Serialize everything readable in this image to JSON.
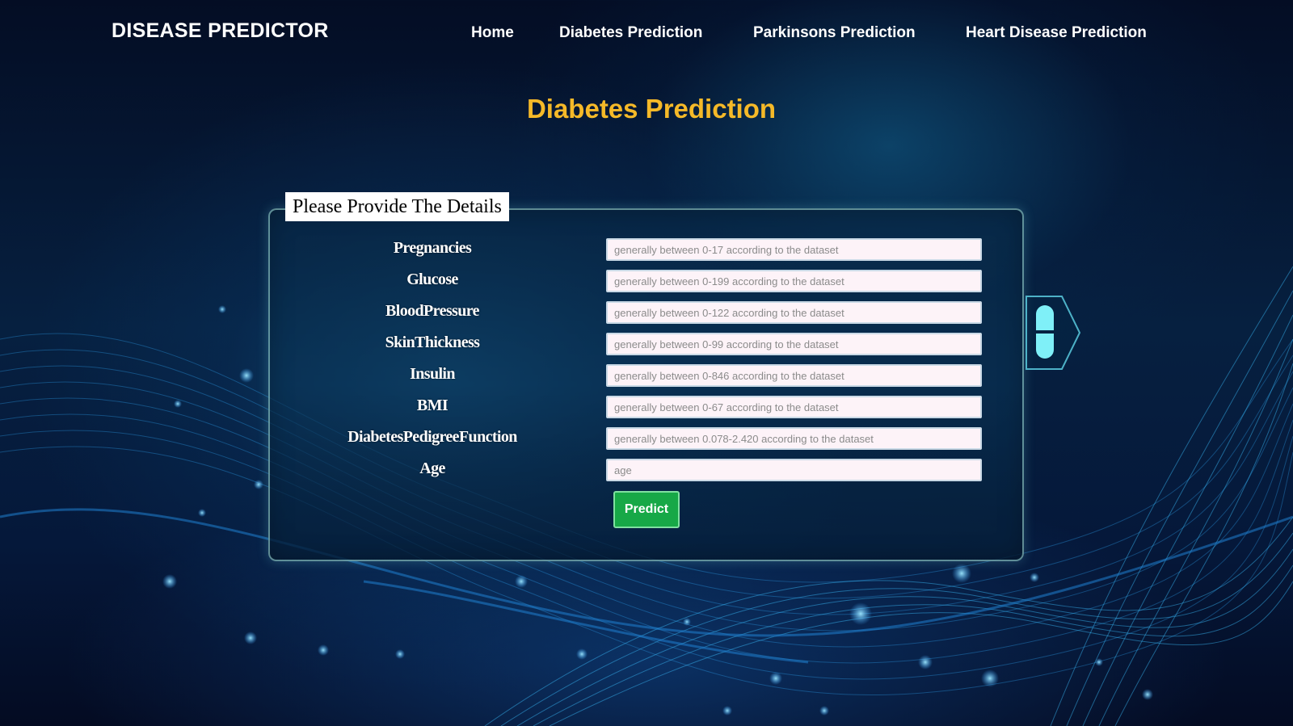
{
  "brand": "DISEASE PREDICTOR",
  "nav": {
    "home": "Home",
    "diabetes": "Diabetes Prediction",
    "parkinsons": "Parkinsons Prediction",
    "heart": "Heart Disease Prediction"
  },
  "page_title": "Diabetes Prediction",
  "form": {
    "legend": "Please Provide The Details",
    "fields": [
      {
        "label": "Pregnancies",
        "value": "",
        "placeholder": "generally between 0-17 according to the dataset"
      },
      {
        "label": "Glucose",
        "value": "",
        "placeholder": "generally between 0-199 according to the dataset"
      },
      {
        "label": "BloodPressure",
        "value": "",
        "placeholder": "generally between 0-122 according to the dataset"
      },
      {
        "label": "SkinThickness",
        "value": "",
        "placeholder": "generally between 0-99 according to the dataset"
      },
      {
        "label": "Insulin",
        "value": "",
        "placeholder": "generally between 0-846 according to the dataset"
      },
      {
        "label": "BMI",
        "value": "",
        "placeholder": "generally between 0-67 according to the dataset"
      },
      {
        "label": "DiabetesPedigreeFunction",
        "value": "",
        "placeholder": "generally between 0.078-2.420 according to the dataset"
      },
      {
        "label": "Age",
        "value": "",
        "placeholder": "age"
      }
    ],
    "submit_label": "Predict"
  },
  "icons": {
    "pill": "pill-capsule-icon"
  },
  "colors": {
    "title_accent": "#f5b928",
    "button": "#17a847",
    "pill": "#7ff0f8"
  }
}
